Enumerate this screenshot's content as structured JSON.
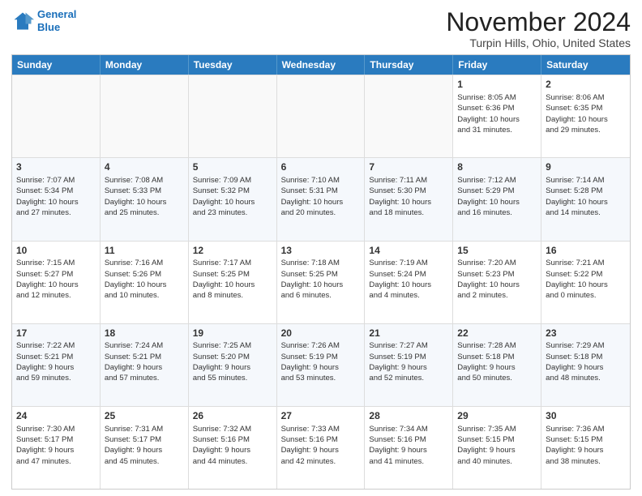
{
  "header": {
    "logo_line1": "General",
    "logo_line2": "Blue",
    "title": "November 2024",
    "subtitle": "Turpin Hills, Ohio, United States"
  },
  "days_of_week": [
    "Sunday",
    "Monday",
    "Tuesday",
    "Wednesday",
    "Thursday",
    "Friday",
    "Saturday"
  ],
  "weeks": [
    [
      {
        "day": "",
        "info": ""
      },
      {
        "day": "",
        "info": ""
      },
      {
        "day": "",
        "info": ""
      },
      {
        "day": "",
        "info": ""
      },
      {
        "day": "",
        "info": ""
      },
      {
        "day": "1",
        "info": "Sunrise: 8:05 AM\nSunset: 6:36 PM\nDaylight: 10 hours\nand 31 minutes."
      },
      {
        "day": "2",
        "info": "Sunrise: 8:06 AM\nSunset: 6:35 PM\nDaylight: 10 hours\nand 29 minutes."
      }
    ],
    [
      {
        "day": "3",
        "info": "Sunrise: 7:07 AM\nSunset: 5:34 PM\nDaylight: 10 hours\nand 27 minutes."
      },
      {
        "day": "4",
        "info": "Sunrise: 7:08 AM\nSunset: 5:33 PM\nDaylight: 10 hours\nand 25 minutes."
      },
      {
        "day": "5",
        "info": "Sunrise: 7:09 AM\nSunset: 5:32 PM\nDaylight: 10 hours\nand 23 minutes."
      },
      {
        "day": "6",
        "info": "Sunrise: 7:10 AM\nSunset: 5:31 PM\nDaylight: 10 hours\nand 20 minutes."
      },
      {
        "day": "7",
        "info": "Sunrise: 7:11 AM\nSunset: 5:30 PM\nDaylight: 10 hours\nand 18 minutes."
      },
      {
        "day": "8",
        "info": "Sunrise: 7:12 AM\nSunset: 5:29 PM\nDaylight: 10 hours\nand 16 minutes."
      },
      {
        "day": "9",
        "info": "Sunrise: 7:14 AM\nSunset: 5:28 PM\nDaylight: 10 hours\nand 14 minutes."
      }
    ],
    [
      {
        "day": "10",
        "info": "Sunrise: 7:15 AM\nSunset: 5:27 PM\nDaylight: 10 hours\nand 12 minutes."
      },
      {
        "day": "11",
        "info": "Sunrise: 7:16 AM\nSunset: 5:26 PM\nDaylight: 10 hours\nand 10 minutes."
      },
      {
        "day": "12",
        "info": "Sunrise: 7:17 AM\nSunset: 5:25 PM\nDaylight: 10 hours\nand 8 minutes."
      },
      {
        "day": "13",
        "info": "Sunrise: 7:18 AM\nSunset: 5:25 PM\nDaylight: 10 hours\nand 6 minutes."
      },
      {
        "day": "14",
        "info": "Sunrise: 7:19 AM\nSunset: 5:24 PM\nDaylight: 10 hours\nand 4 minutes."
      },
      {
        "day": "15",
        "info": "Sunrise: 7:20 AM\nSunset: 5:23 PM\nDaylight: 10 hours\nand 2 minutes."
      },
      {
        "day": "16",
        "info": "Sunrise: 7:21 AM\nSunset: 5:22 PM\nDaylight: 10 hours\nand 0 minutes."
      }
    ],
    [
      {
        "day": "17",
        "info": "Sunrise: 7:22 AM\nSunset: 5:21 PM\nDaylight: 9 hours\nand 59 minutes."
      },
      {
        "day": "18",
        "info": "Sunrise: 7:24 AM\nSunset: 5:21 PM\nDaylight: 9 hours\nand 57 minutes."
      },
      {
        "day": "19",
        "info": "Sunrise: 7:25 AM\nSunset: 5:20 PM\nDaylight: 9 hours\nand 55 minutes."
      },
      {
        "day": "20",
        "info": "Sunrise: 7:26 AM\nSunset: 5:19 PM\nDaylight: 9 hours\nand 53 minutes."
      },
      {
        "day": "21",
        "info": "Sunrise: 7:27 AM\nSunset: 5:19 PM\nDaylight: 9 hours\nand 52 minutes."
      },
      {
        "day": "22",
        "info": "Sunrise: 7:28 AM\nSunset: 5:18 PM\nDaylight: 9 hours\nand 50 minutes."
      },
      {
        "day": "23",
        "info": "Sunrise: 7:29 AM\nSunset: 5:18 PM\nDaylight: 9 hours\nand 48 minutes."
      }
    ],
    [
      {
        "day": "24",
        "info": "Sunrise: 7:30 AM\nSunset: 5:17 PM\nDaylight: 9 hours\nand 47 minutes."
      },
      {
        "day": "25",
        "info": "Sunrise: 7:31 AM\nSunset: 5:17 PM\nDaylight: 9 hours\nand 45 minutes."
      },
      {
        "day": "26",
        "info": "Sunrise: 7:32 AM\nSunset: 5:16 PM\nDaylight: 9 hours\nand 44 minutes."
      },
      {
        "day": "27",
        "info": "Sunrise: 7:33 AM\nSunset: 5:16 PM\nDaylight: 9 hours\nand 42 minutes."
      },
      {
        "day": "28",
        "info": "Sunrise: 7:34 AM\nSunset: 5:16 PM\nDaylight: 9 hours\nand 41 minutes."
      },
      {
        "day": "29",
        "info": "Sunrise: 7:35 AM\nSunset: 5:15 PM\nDaylight: 9 hours\nand 40 minutes."
      },
      {
        "day": "30",
        "info": "Sunrise: 7:36 AM\nSunset: 5:15 PM\nDaylight: 9 hours\nand 38 minutes."
      }
    ]
  ]
}
